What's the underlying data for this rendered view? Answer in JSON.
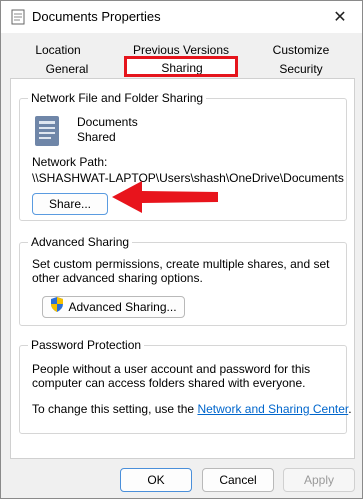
{
  "window": {
    "title": "Documents Properties"
  },
  "tabs": {
    "row1": [
      "Location",
      "Previous Versions",
      "Customize"
    ],
    "row2": [
      "General",
      "Sharing",
      "Security"
    ]
  },
  "network": {
    "group_title": "Network File and Folder Sharing",
    "item_name": "Documents",
    "item_status": "Shared",
    "path_label": "Network Path:",
    "path_value": "\\\\SHASHWAT-LAPTOP\\Users\\shash\\OneDrive\\Documents",
    "share_button": "Share..."
  },
  "advanced": {
    "group_title": "Advanced Sharing",
    "description": "Set custom permissions, create multiple shares, and set other advanced sharing options.",
    "button": "Advanced Sharing..."
  },
  "password": {
    "group_title": "Password Protection",
    "description": "People without a user account and password for this computer can access folders shared with everyone.",
    "change_prefix": "To change this setting, use the ",
    "change_link": "Network and Sharing Center",
    "change_suffix": "."
  },
  "footer": {
    "ok": "OK",
    "cancel": "Cancel",
    "apply": "Apply"
  },
  "colors": {
    "highlight": "#e5141c",
    "link": "#0066cc",
    "arrow": "#e8141c"
  },
  "icons": [
    "folder-properties-icon",
    "close-icon",
    "documents-library-icon",
    "uac-shield-icon",
    "red-arrow-icon"
  ]
}
